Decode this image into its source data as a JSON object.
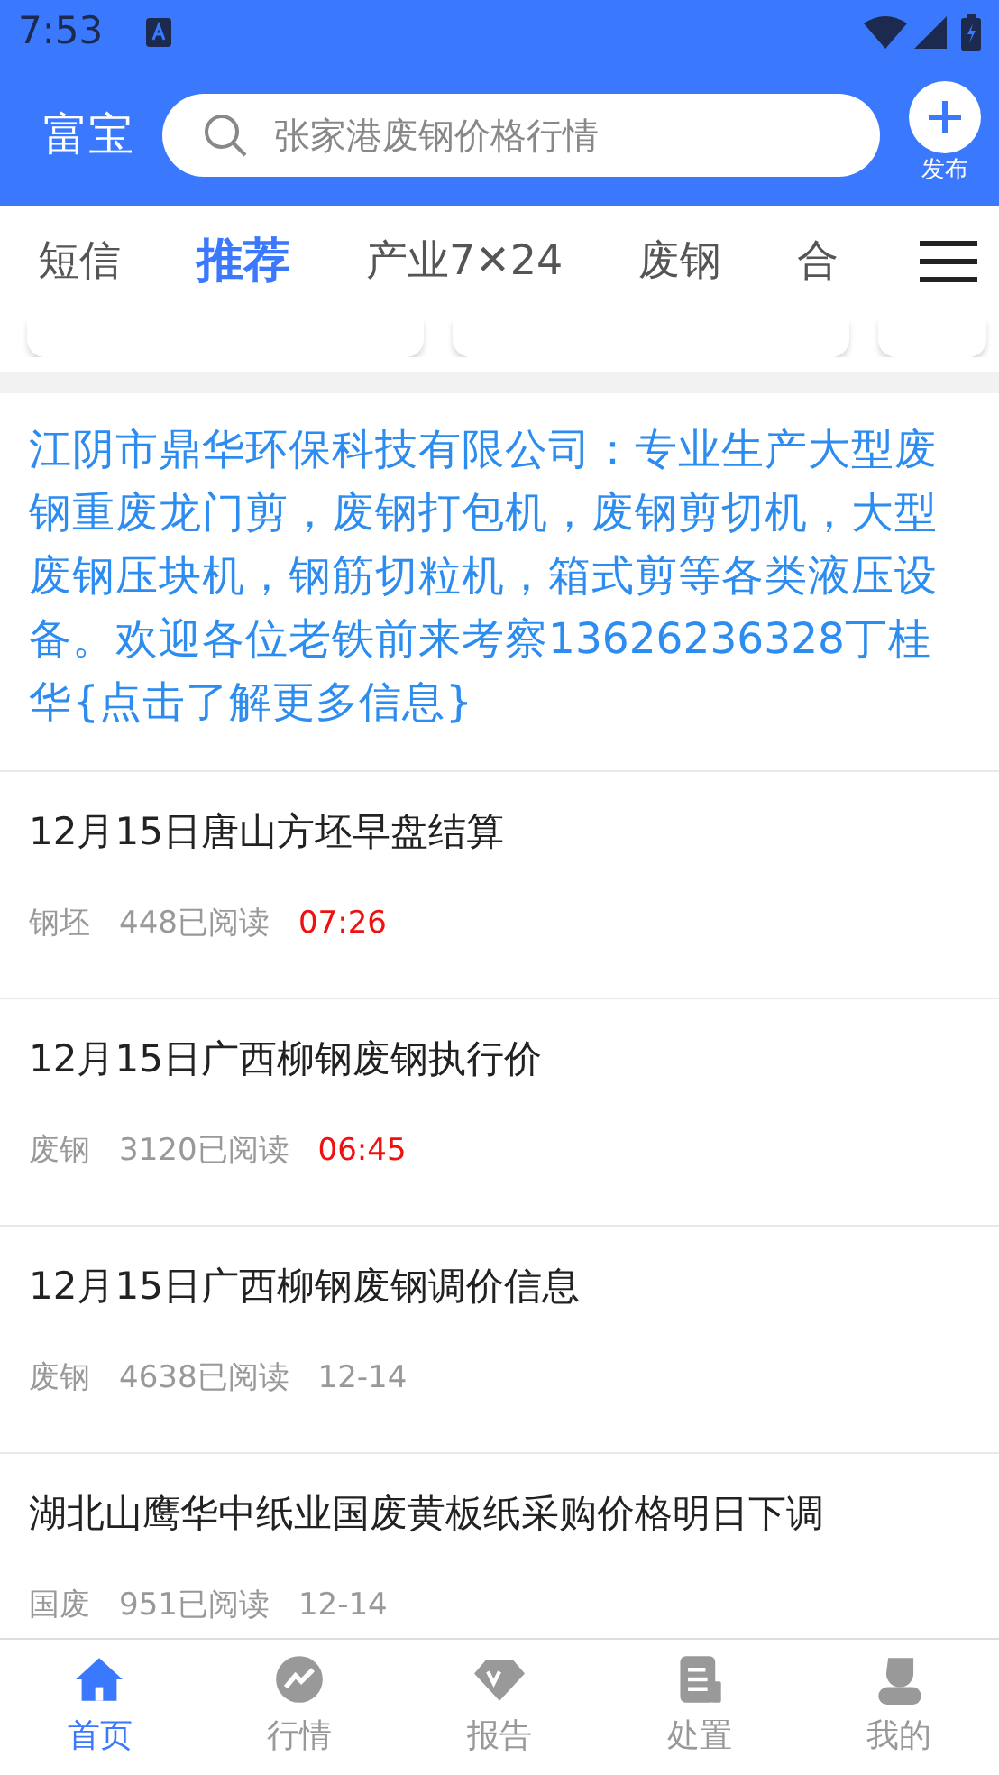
{
  "status_bar": {
    "time": "7:53"
  },
  "header": {
    "logo": "富宝",
    "search": {
      "placeholder": "张家港废钢价格行情"
    },
    "publish_label": "发布"
  },
  "tabs": [
    {
      "label": "短信",
      "selected": false
    },
    {
      "label": "推荐",
      "selected": true
    },
    {
      "label": "产业7✕24",
      "selected": false
    },
    {
      "label": "废钢",
      "selected": false
    },
    {
      "label": "合",
      "selected": false
    }
  ],
  "ad_text": "江阴市鼎华环保科技有限公司：专业生产大型废钢重废龙门剪，废钢打包机，废钢剪切机，大型废钢压块机，钢筋切粒机，箱式剪等各类液压设备。欢迎各位老铁前来考察13626236328丁桂华{点击了解更多信息}",
  "articles": [
    {
      "title": "12月15日唐山方坯早盘结算",
      "tag": "钢坯",
      "reads": "448已阅读",
      "time": "07:26",
      "recent": true
    },
    {
      "title": "12月15日广西柳钢废钢执行价",
      "tag": "废钢",
      "reads": "3120已阅读",
      "time": "06:45",
      "recent": true
    },
    {
      "title": "12月15日广西柳钢废钢调价信息",
      "tag": "废钢",
      "reads": "4638已阅读",
      "time": "12-14",
      "recent": false
    },
    {
      "title": "湖北山鹰华中纸业国废黄板纸采购价格明日下调",
      "tag": "国废",
      "reads": "951已阅读",
      "time": "12-14",
      "recent": false
    }
  ],
  "bottom_nav": [
    {
      "label": "首页",
      "kind": "home",
      "selected": true
    },
    {
      "label": "行情",
      "kind": "chart",
      "selected": false
    },
    {
      "label": "报告",
      "kind": "vip",
      "selected": false
    },
    {
      "label": "处置",
      "kind": "doc",
      "selected": false
    },
    {
      "label": "我的",
      "kind": "user",
      "selected": false
    }
  ]
}
